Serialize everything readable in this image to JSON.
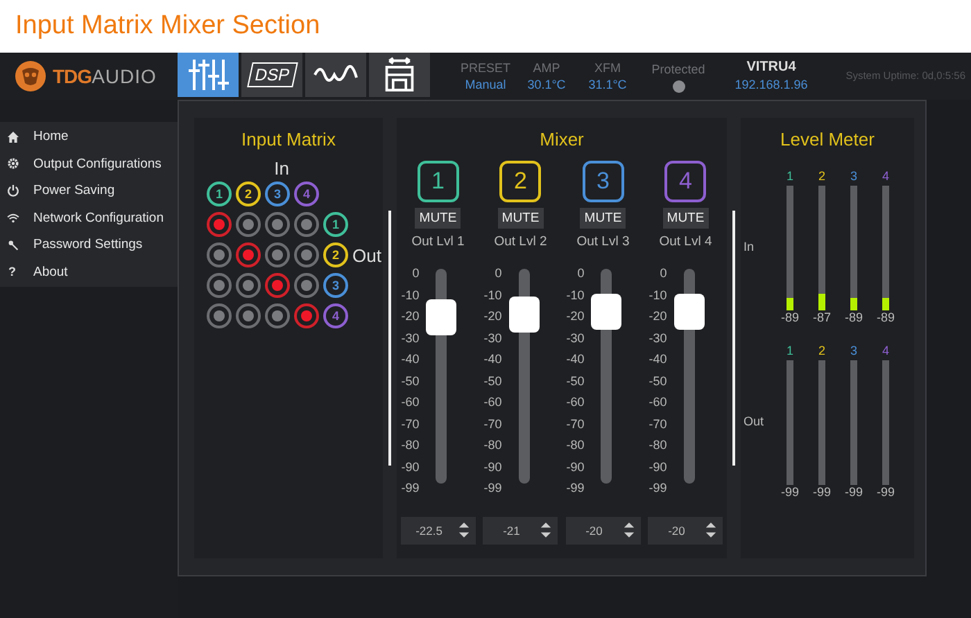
{
  "page_title": "Input Matrix Mixer Section",
  "logo": {
    "brand": "TDG",
    "suffix": "AUDIO"
  },
  "toolbar": [
    {
      "kind": "sliders",
      "selected": true
    },
    {
      "kind": "label",
      "label": "DSP",
      "selected": false
    },
    {
      "kind": "wave",
      "selected": false
    },
    {
      "kind": "frame",
      "selected": false
    }
  ],
  "status": [
    {
      "kind": "reading",
      "label": "PRESET",
      "value": "Manual"
    },
    {
      "kind": "reading",
      "label": "AMP",
      "value": "30.1°C"
    },
    {
      "kind": "reading",
      "label": "XFM",
      "value": "31.1°C"
    },
    {
      "kind": "indicator",
      "label": "Protected",
      "on": false
    },
    {
      "kind": "device",
      "label": "VITRU4",
      "value": "192.168.1.96"
    },
    {
      "kind": "uptime",
      "label": "System Uptime: 0d,0:5:56"
    }
  ],
  "sidebar": {
    "items": [
      {
        "kind": "home",
        "label": "Home"
      },
      {
        "kind": "gear",
        "label": "Output Configurations"
      },
      {
        "kind": "power",
        "label": "Power Saving"
      },
      {
        "kind": "wifi",
        "label": "Network Configuration"
      },
      {
        "kind": "key",
        "label": "Password Settings"
      },
      {
        "kind": "glyph",
        "glyph": "?",
        "label": "About"
      }
    ]
  },
  "input_matrix": {
    "title": "Input Matrix",
    "in_label": "In",
    "inputs": [
      {
        "label": "1",
        "color": "#3fbf9a"
      },
      {
        "label": "2",
        "color": "#e2c21c"
      },
      {
        "label": "3",
        "color": "#4a8fd8"
      },
      {
        "label": "4",
        "color": "#8d5fd0"
      }
    ],
    "rows": [
      {
        "output": {
          "label": "1",
          "color": "#3fbf9a"
        },
        "cells": [
          {
            "on": true
          },
          {
            "on": false
          },
          {
            "on": false
          },
          {
            "on": false
          }
        ]
      },
      {
        "output": {
          "label": "2",
          "color": "#e2c21c"
        },
        "side_label": "Out",
        "cells": [
          {
            "on": false
          },
          {
            "on": true
          },
          {
            "on": false
          },
          {
            "on": false
          }
        ]
      },
      {
        "output": {
          "label": "3",
          "color": "#4a8fd8"
        },
        "cells": [
          {
            "on": false
          },
          {
            "on": false
          },
          {
            "on": true
          },
          {
            "on": false
          }
        ]
      },
      {
        "output": {
          "label": "4",
          "color": "#8d5fd0"
        },
        "cells": [
          {
            "on": false
          },
          {
            "on": false
          },
          {
            "on": false
          },
          {
            "on": true
          }
        ]
      }
    ]
  },
  "mixer": {
    "title": "Mixer",
    "channels": [
      {
        "label": "1",
        "color": "#3fbf9a",
        "mute": "MUTE",
        "name": "Out Lvl 1",
        "scale": [
          "0",
          "-10",
          "-20",
          "-30",
          "-40",
          "-50",
          "-60",
          "-70",
          "-80",
          "-90",
          "-99"
        ],
        "level": 0.773,
        "value": "-22.5"
      },
      {
        "label": "2",
        "color": "#e2c21c",
        "mute": "MUTE",
        "name": "Out Lvl 2",
        "scale": [
          "0",
          "-10",
          "-20",
          "-30",
          "-40",
          "-50",
          "-60",
          "-70",
          "-80",
          "-90",
          "-99"
        ],
        "level": 0.788,
        "value": "-21"
      },
      {
        "label": "3",
        "color": "#4a8fd8",
        "mute": "MUTE",
        "name": "Out Lvl 3",
        "scale": [
          "0",
          "-10",
          "-20",
          "-30",
          "-40",
          "-50",
          "-60",
          "-70",
          "-80",
          "-90",
          "-99"
        ],
        "level": 0.798,
        "value": "-20"
      },
      {
        "label": "4",
        "color": "#8d5fd0",
        "mute": "MUTE",
        "name": "Out Lvl 4",
        "scale": [
          "0",
          "-10",
          "-20",
          "-30",
          "-40",
          "-50",
          "-60",
          "-70",
          "-80",
          "-90",
          "-99"
        ],
        "level": 0.798,
        "value": "-20"
      }
    ]
  },
  "level_meter": {
    "title": "Level Meter",
    "groups": [
      {
        "label": "In",
        "meters": [
          {
            "label": "1",
            "color": "#3fbf9a",
            "level": 0.1,
            "reading": "-89"
          },
          {
            "label": "2",
            "color": "#e2c21c",
            "level": 0.13,
            "reading": "-87"
          },
          {
            "label": "3",
            "color": "#4a8fd8",
            "level": 0.1,
            "reading": "-89"
          },
          {
            "label": "4",
            "color": "#8d5fd0",
            "level": 0.1,
            "reading": "-89"
          }
        ]
      },
      {
        "label": "Out",
        "meters": [
          {
            "label": "1",
            "color": "#3fbf9a",
            "reading": "-99"
          },
          {
            "label": "2",
            "color": "#e2c21c",
            "reading": "-99"
          },
          {
            "label": "3",
            "color": "#4a8fd8",
            "reading": "-99"
          },
          {
            "label": "4",
            "color": "#8d5fd0",
            "reading": "-99"
          }
        ]
      }
    ]
  }
}
